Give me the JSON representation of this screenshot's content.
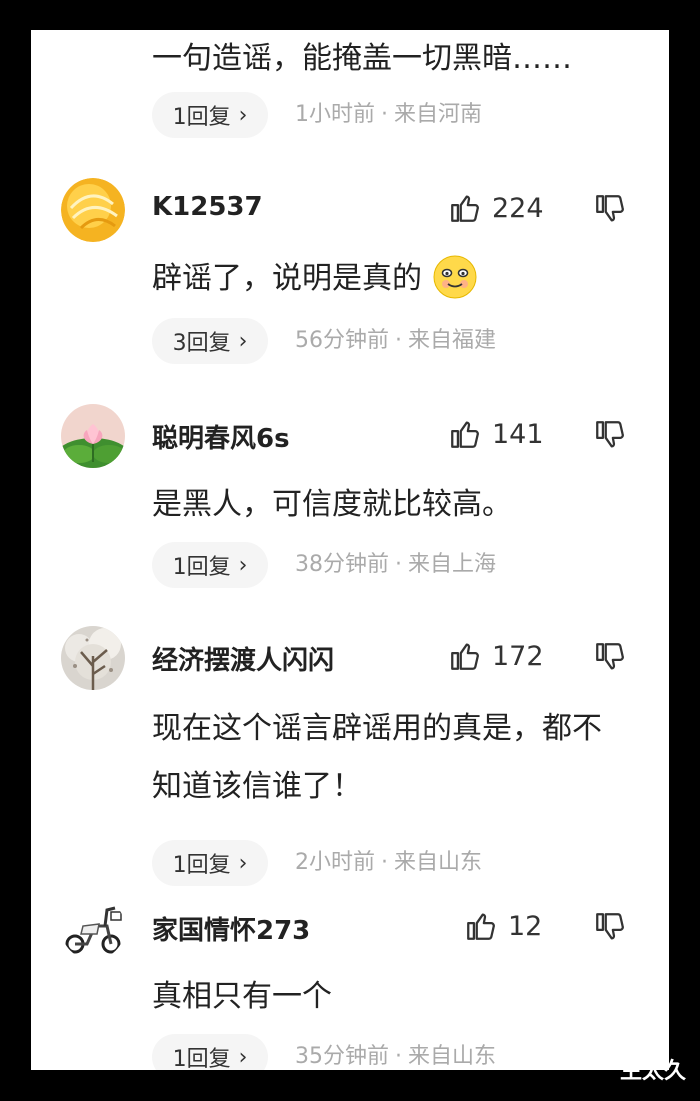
{
  "top_comment": {
    "text": "一句造谣，能掩盖一切黑暗……",
    "replies": "1回复",
    "time": "1小时前",
    "location": "来自河南"
  },
  "comments": [
    {
      "username": "K12537",
      "likes": "224",
      "text": "辟谣了，说明是真的",
      "emoji": "smiling-face-emoji",
      "replies": "3回复",
      "time": "56分钟前",
      "location": "来自福建",
      "avatar_icon": "orange-noodles-avatar"
    },
    {
      "username": "聪明春风6s",
      "likes": "141",
      "text": "是黑人，可信度就比较高。",
      "replies": "1回复",
      "time": "38分钟前",
      "location": "来自上海",
      "avatar_icon": "lotus-avatar"
    },
    {
      "username": "经济摆渡人闪闪",
      "likes": "172",
      "text": "现在这个谣言辟谣用的真是，都不知道该信谁了！",
      "replies": "1回复",
      "time": "2小时前",
      "location": "来自山东",
      "avatar_icon": "tree-avatar"
    },
    {
      "username": "家国情怀273",
      "likes": "12",
      "text": "真相只有一个",
      "replies": "1回复",
      "time": "35分钟前",
      "location": "来自山东",
      "avatar_icon": "scooter-avatar"
    }
  ],
  "icons": {
    "like": "thumbs-up-icon",
    "dislike": "thumbs-down-icon",
    "chevron": "chevron-right-icon"
  },
  "watermark": "生太久",
  "colors": {
    "meta": "#aaaaaa",
    "reply_bg": "#f5f5f5",
    "text": "#222222"
  }
}
